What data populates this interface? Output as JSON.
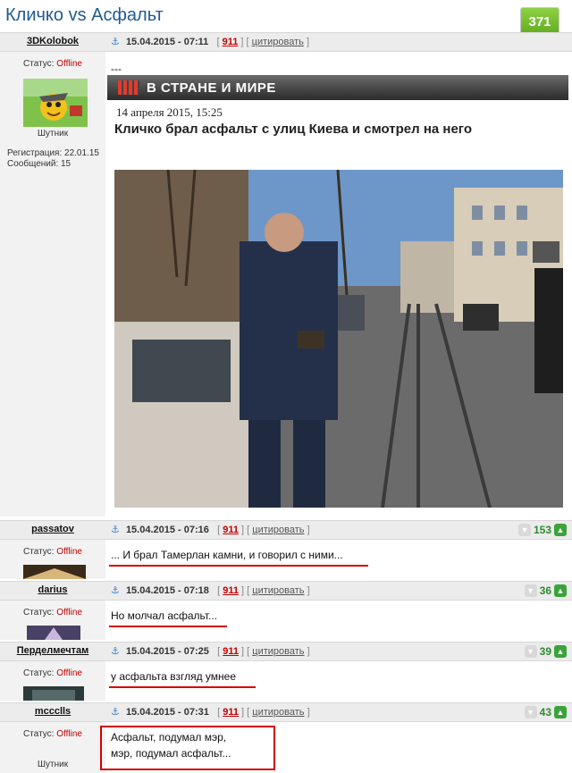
{
  "topic": {
    "title": "Кличко vs Асфальт"
  },
  "topic_rating": {
    "value": "371",
    "minus": "−",
    "plus": "+"
  },
  "posts": [
    {
      "author": "3DKolobok",
      "date": "15.04.2015 - 07:11",
      "number": "911",
      "quote_label": "цитировать",
      "status_label": "Статус:",
      "status": "Offline",
      "rank": "Шутник",
      "registration": "Регистрация: 22.01.15",
      "messages": "Сообщений: 15",
      "message": "---",
      "article": {
        "banner": "В СТРАНЕ И МИРЕ",
        "date": "14 апреля 2015, 15:25",
        "headline": "Кличко брал асфальт с улиц Киева и смотрел на него"
      }
    },
    {
      "author": "passatov",
      "date": "15.04.2015 - 07:16",
      "number": "911",
      "quote_label": "цитировать",
      "status_label": "Статус:",
      "status": "Offline",
      "score": "153",
      "message": "... И брал Тамерлан камни, и говорил с ними..."
    },
    {
      "author": "darius",
      "date": "15.04.2015 - 07:18",
      "number": "911",
      "quote_label": "цитировать",
      "status_label": "Статус:",
      "status": "Offline",
      "score": "36",
      "message": "Но молчал асфальт..."
    },
    {
      "author": "Перделмечтам",
      "date": "15.04.2015 - 07:25",
      "number": "911",
      "quote_label": "цитировать",
      "status_label": "Статус:",
      "status": "Offline",
      "score": "39",
      "message": "у асфальта взгляд умнее"
    },
    {
      "author": "mccclls",
      "date": "15.04.2015 - 07:31",
      "number": "911",
      "quote_label": "цитировать",
      "status_label": "Статус:",
      "status": "Offline",
      "score": "43",
      "rank": "Шутник",
      "message_line1": "Асфальт, подумал мэр,",
      "message_line2": "мэр, подумал асфальт..."
    }
  ],
  "icons": {
    "anchor": "anchor-icon",
    "vote_up": "thumb-up-icon",
    "vote_down": "thumb-down-icon"
  },
  "colors": {
    "offline": "#c40000",
    "post_number": "#c40000",
    "score": "#2e8b2e",
    "title": "#1f5a8e"
  }
}
